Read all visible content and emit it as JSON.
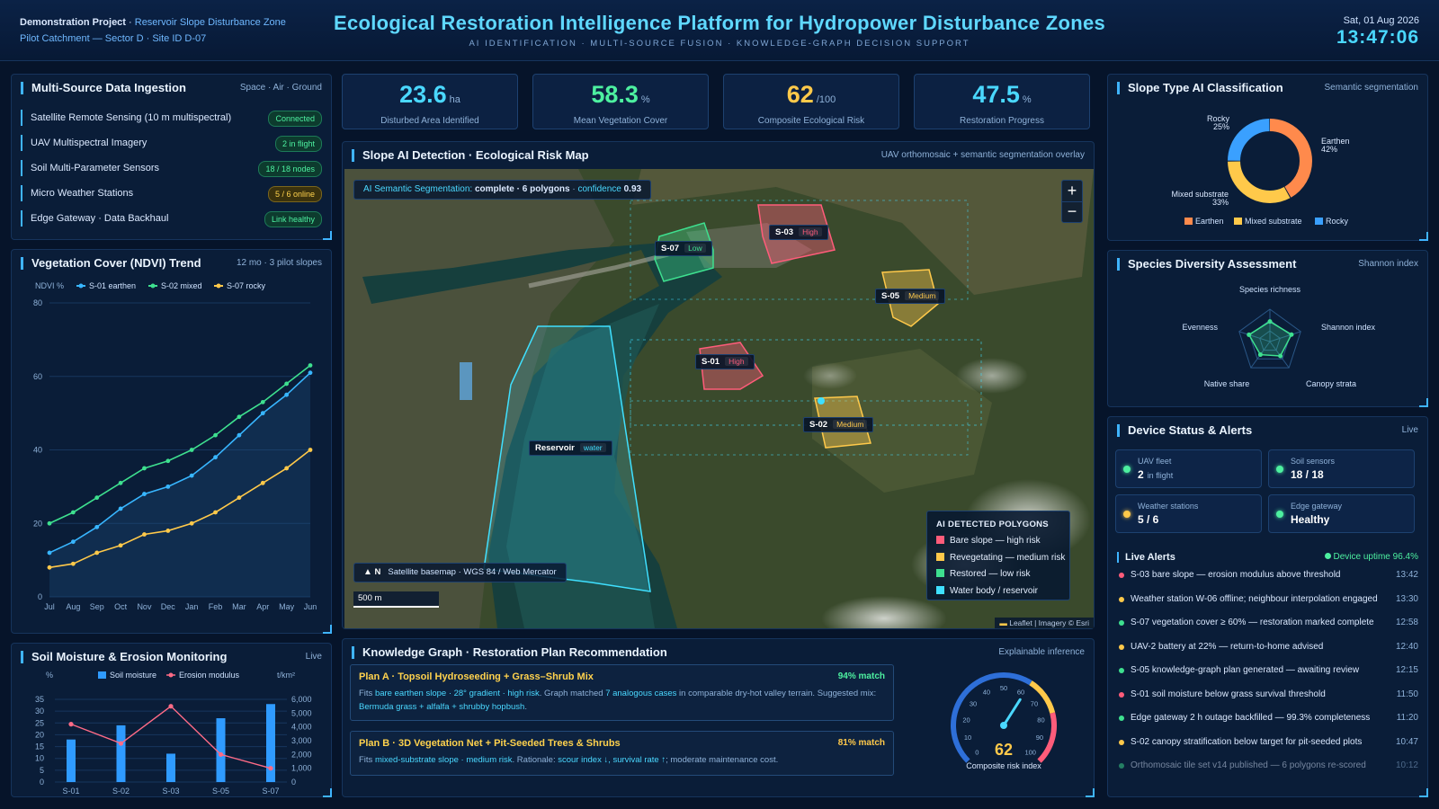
{
  "header": {
    "project_label": "Demonstration Project",
    "project_sep": " · ",
    "project_name": "Reservoir Slope Disturbance Zone",
    "site_line": "Pilot Catchment — Sector D · Site ID D-07",
    "title": "Ecological Restoration Intelligence Platform for Hydropower Disturbance Zones",
    "subtitle": "AI IDENTIFICATION · MULTI-SOURCE FUSION · KNOWLEDGE-GRAPH DECISION SUPPORT",
    "date": "Sat, 01 Aug 2026",
    "time": "13:47:06"
  },
  "ingestion": {
    "title": "Multi-Source Data Ingestion",
    "subtitle": "Space · Air · Ground",
    "rows": [
      {
        "label": "Satellite Remote Sensing (10 m multispectral)",
        "status": "Connected",
        "tone": "green"
      },
      {
        "label": "UAV Multispectral Imagery",
        "status": "2 in flight",
        "tone": "green"
      },
      {
        "label": "Soil Multi-Parameter Sensors",
        "status": "18 / 18 nodes",
        "tone": "green"
      },
      {
        "label": "Micro Weather Stations",
        "status": "5 / 6 online",
        "tone": "yellow"
      },
      {
        "label": "Edge Gateway · Data Backhaul",
        "status": "Link healthy",
        "tone": "green"
      }
    ]
  },
  "ndvi": {
    "title": "Vegetation Cover (NDVI) Trend",
    "subtitle": "12 mo · 3 pilot slopes",
    "unit_label": "NDVI %",
    "chart_data": {
      "type": "area",
      "x": [
        "Jul",
        "Aug",
        "Sep",
        "Oct",
        "Nov",
        "Dec",
        "Jan",
        "Feb",
        "Mar",
        "Apr",
        "May",
        "Jun"
      ],
      "ylim": [
        0,
        80
      ],
      "yticks": [
        0,
        20,
        40,
        60,
        80
      ],
      "series": [
        {
          "name": "S-01 earthen",
          "color": "#38b6ff",
          "values": [
            12,
            15,
            19,
            24,
            28,
            30,
            33,
            38,
            44,
            50,
            55,
            61
          ]
        },
        {
          "name": "S-02 mixed",
          "color": "#3ee08f",
          "values": [
            20,
            23,
            27,
            31,
            35,
            37,
            40,
            44,
            49,
            53,
            58,
            63
          ]
        },
        {
          "name": "S-07 rocky",
          "color": "#ffc94a",
          "values": [
            8,
            9,
            12,
            14,
            17,
            18,
            20,
            23,
            27,
            31,
            35,
            40
          ]
        }
      ]
    }
  },
  "soil": {
    "title": "Soil Moisture & Erosion Monitoring",
    "subtitle": "Live",
    "left_unit": "%",
    "right_unit": "t/km²",
    "chart_data": {
      "type": "bar",
      "categories": [
        "S-01",
        "S-02",
        "S-03",
        "S-05",
        "S-07"
      ],
      "series": [
        {
          "name": "Soil moisture",
          "color": "#2f9bff",
          "axis": "left",
          "values": [
            18,
            24,
            12,
            27,
            33
          ]
        },
        {
          "name": "Erosion modulus",
          "color": "#ff6b86",
          "axis": "right",
          "values": [
            4200,
            2800,
            5500,
            2000,
            1000
          ]
        }
      ],
      "left_ticks": [
        0,
        5,
        10,
        15,
        20,
        25,
        30,
        35
      ],
      "left_lim": [
        0,
        35
      ],
      "right_ticks": [
        "0",
        "1,000",
        "2,000",
        "3,000",
        "4,000",
        "5,000",
        "6,000"
      ],
      "right_lim": [
        0,
        6000
      ]
    }
  },
  "kpis": [
    {
      "value": "23.6",
      "unit": "ha",
      "label": "Disturbed Area Identified",
      "color": "#4ad8ff"
    },
    {
      "value": "58.3",
      "unit": "%",
      "label": "Mean Vegetation Cover",
      "color": "#4df0a0"
    },
    {
      "value": "62",
      "unit": "/100",
      "label": "Composite Ecological Risk",
      "color": "#ffc94a"
    },
    {
      "value": "47.5",
      "unit": "%",
      "label": "Restoration Progress",
      "color": "#4ad8ff"
    }
  ],
  "map": {
    "title": "Slope AI Detection · Ecological Risk Map",
    "subtitle": "UAV orthomosaic + semantic segmentation overlay",
    "seg_label": "AI Semantic Segmentation:",
    "seg_status": "complete · 6 polygons",
    "seg_conf_label": "confidence",
    "seg_conf": "0.93",
    "zoom_in": "+",
    "zoom_out": "−",
    "basemap": "Satellite basemap · WGS 84 / Web Mercator",
    "north": "N",
    "scale": "500 m",
    "attribution": "Leaflet | Imagery © Esri",
    "polygons": [
      {
        "id": "S-07",
        "risk": "Low",
        "color": "#3ee08f"
      },
      {
        "id": "S-03",
        "risk": "High",
        "color": "#ff5c7a"
      },
      {
        "id": "S-05",
        "risk": "Medium",
        "color": "#ffc94a"
      },
      {
        "id": "S-01",
        "risk": "High",
        "color": "#ff5c7a"
      },
      {
        "id": "S-02",
        "risk": "Medium",
        "color": "#ffc94a"
      },
      {
        "id": "Reservoir",
        "risk": "water",
        "color": "#3fe0ff"
      }
    ],
    "legend_title": "AI DETECTED POLYGONS",
    "legend": [
      {
        "label": "Bare slope — high risk",
        "color": "#ff5c7a"
      },
      {
        "label": "Revegetating — medium risk",
        "color": "#ffc94a"
      },
      {
        "label": "Restored — low risk",
        "color": "#3ee08f"
      },
      {
        "label": "Water body / reservoir",
        "color": "#3fe0ff"
      }
    ]
  },
  "kg": {
    "title": "Knowledge Graph · Restoration Plan Recommendation",
    "subtitle": "Explainable inference",
    "planA": {
      "title": "Plan A · Topsoil Hydroseeding + Grass–Shrub Mix",
      "match": "94% match",
      "p1": "Fits ",
      "h1": "bare earthen slope · 28° gradient · high risk",
      "p2": ". Graph matched ",
      "h2": "7 analogous cases",
      "p3": " in comparable dry-hot valley terrain. Suggested mix: ",
      "h3": "Bermuda grass + alfalfa + shrubby hopbush",
      "p4": "."
    },
    "planB": {
      "title": "Plan B · 3D Vegetation Net + Pit-Seeded Trees & Shrubs",
      "match": "81% match",
      "p1": "Fits ",
      "h1": "mixed-substrate slope · medium risk",
      "p2": ". Rationale: ",
      "h2": "scour index ↓, survival rate ↑",
      "p3": "; moderate maintenance cost."
    },
    "gauge": {
      "value": 62,
      "max": 100,
      "ticks": [
        "0",
        "10",
        "20",
        "30",
        "40",
        "50",
        "60",
        "70",
        "80",
        "90",
        "100"
      ],
      "label": "Composite risk index"
    }
  },
  "slope": {
    "title": "Slope Type AI Classification",
    "subtitle": "Semantic segmentation",
    "chart_data": {
      "type": "pie",
      "slices": [
        {
          "name": "Earthen",
          "value": 42,
          "color": "#ff8a4c"
        },
        {
          "name": "Mixed substrate",
          "value": 33,
          "color": "#ffc94a"
        },
        {
          "name": "Rocky",
          "value": 25,
          "color": "#3aa0ff"
        }
      ]
    }
  },
  "species": {
    "title": "Species Diversity Assessment",
    "subtitle": "Shannon index",
    "chart_data": {
      "type": "radar",
      "axes": [
        "Species richness",
        "Shannon index",
        "Canopy strata",
        "Native share",
        "Evenness"
      ],
      "values": [
        0.62,
        0.7,
        0.55,
        0.5,
        0.68
      ],
      "max": 1
    }
  },
  "devices": {
    "title": "Device Status & Alerts",
    "subtitle": "Live",
    "cards": [
      {
        "label": "UAV fleet",
        "value": "2",
        "suffix": "in flight",
        "color": "#4df0a0"
      },
      {
        "label": "Soil sensors",
        "value": "18 / 18",
        "suffix": "",
        "color": "#4df0a0"
      },
      {
        "label": "Weather stations",
        "value": "5 / 6",
        "suffix": "",
        "color": "#ffc94a"
      },
      {
        "label": "Edge gateway",
        "value": "Healthy",
        "suffix": "",
        "color": "#4df0a0"
      }
    ],
    "alerts_title": "Live Alerts",
    "uptime": "Device uptime 96.4%",
    "alerts": [
      {
        "text": "S-03 bare slope — erosion modulus above threshold",
        "time": "13:42",
        "color": "#ff5c7a"
      },
      {
        "text": "Weather station W-06 offline; neighbour interpolation engaged",
        "time": "13:30",
        "color": "#ffc94a"
      },
      {
        "text": "S-07 vegetation cover ≥ 60% — restoration marked complete",
        "time": "12:58",
        "color": "#3ee08f"
      },
      {
        "text": "UAV-2 battery at 22% — return-to-home advised",
        "time": "12:40",
        "color": "#ffc94a"
      },
      {
        "text": "S-05 knowledge-graph plan generated — awaiting review",
        "time": "12:15",
        "color": "#3ee08f"
      },
      {
        "text": "S-01 soil moisture below grass survival threshold",
        "time": "11:50",
        "color": "#ff5c7a"
      },
      {
        "text": "Edge gateway 2 h outage backfilled — 99.3% completeness",
        "time": "11:20",
        "color": "#3ee08f"
      },
      {
        "text": "S-02 canopy stratification below target for pit-seeded plots",
        "time": "10:47",
        "color": "#ffc94a"
      },
      {
        "text": "Orthomosaic tile set v14 published — 6 polygons re-scored",
        "time": "10:12",
        "color": "#3ee08f"
      }
    ]
  }
}
